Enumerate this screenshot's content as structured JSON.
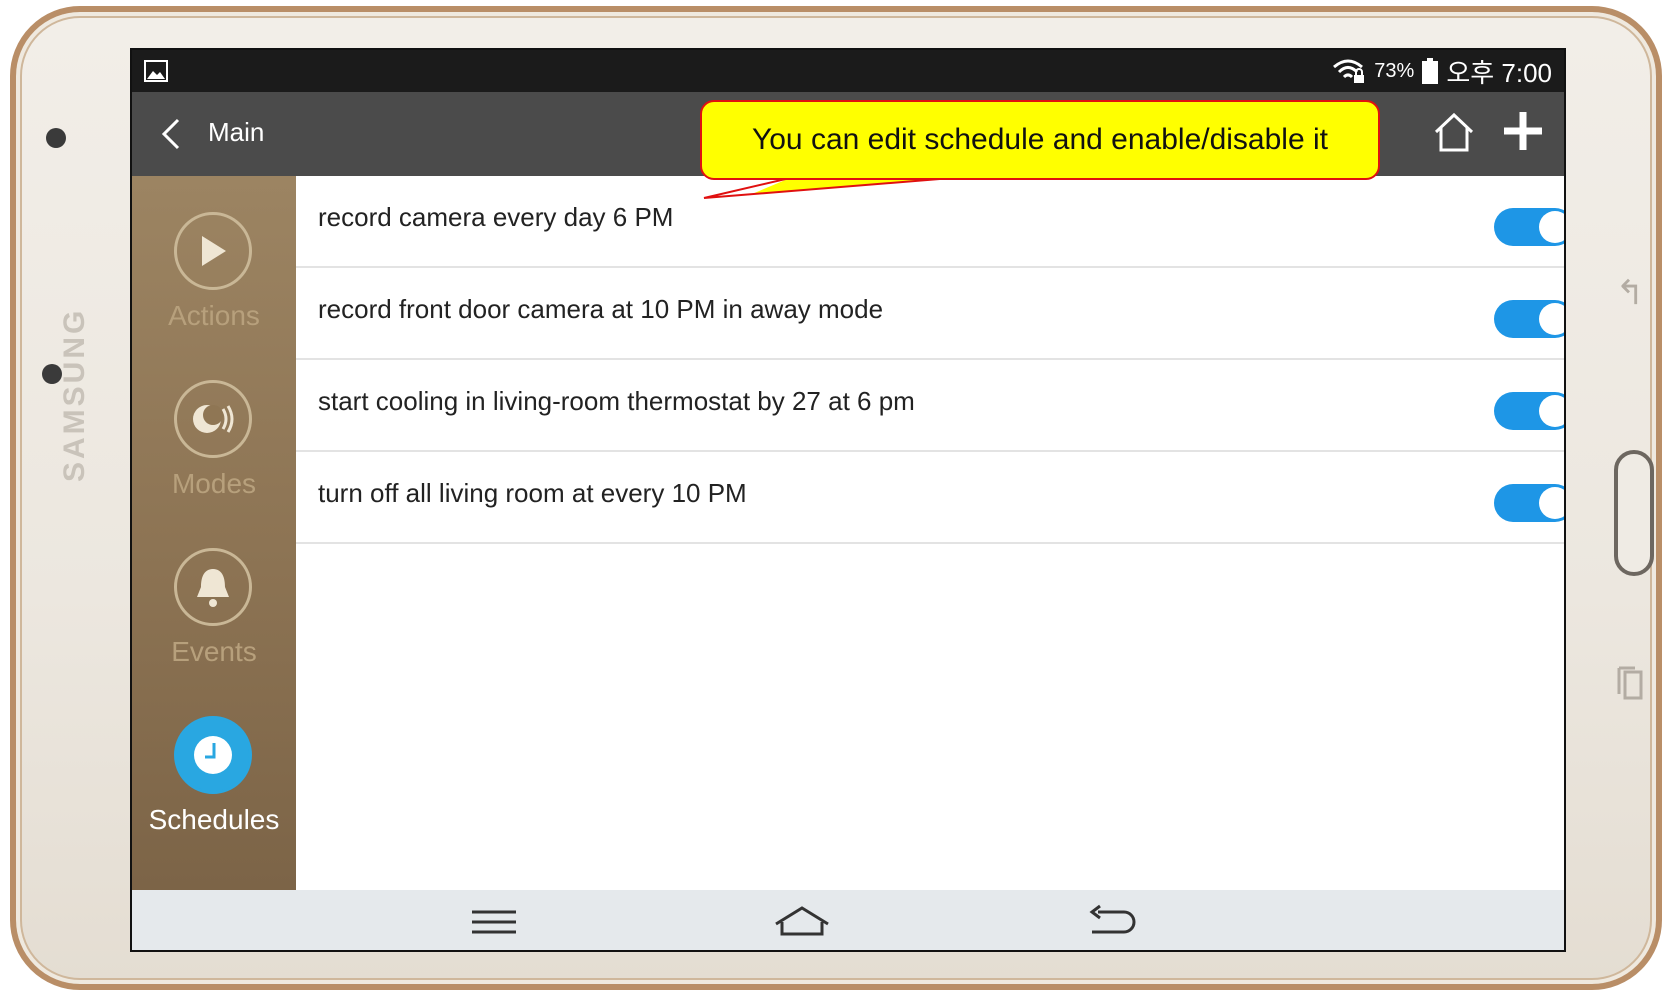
{
  "device": {
    "brand": "SAMSUNG"
  },
  "status_bar": {
    "battery": "73%",
    "time": "오후 7:00",
    "icons": [
      "gallery-icon",
      "wifi-lock-icon",
      "battery-icon"
    ]
  },
  "app_bar": {
    "title": "Main",
    "icons": [
      "back-icon",
      "home-icon",
      "add-icon"
    ]
  },
  "sidebar": {
    "items": [
      {
        "label": "Actions",
        "icon": "play-icon",
        "active": false
      },
      {
        "label": "Modes",
        "icon": "mode-icon",
        "active": false
      },
      {
        "label": "Events",
        "icon": "bell-icon",
        "active": false
      },
      {
        "label": "Schedules",
        "icon": "clock-icon",
        "active": true
      }
    ]
  },
  "schedules": [
    {
      "text": "record camera every day 6 PM",
      "enabled": true
    },
    {
      "text": "record front door camera at 10 PM in away mode",
      "enabled": true
    },
    {
      "text": "start cooling in living-room thermostat by 27 at 6 pm",
      "enabled": true
    },
    {
      "text": "turn off all living room at every 10 PM",
      "enabled": true
    }
  ],
  "callout": {
    "text": "You can edit schedule and enable/disable it"
  },
  "colors": {
    "accent": "#1e96e6",
    "sidebar": "#8c7353",
    "app_bar": "#4b4b4b",
    "callout_fill": "#ffff00",
    "callout_border": "#e01010"
  }
}
